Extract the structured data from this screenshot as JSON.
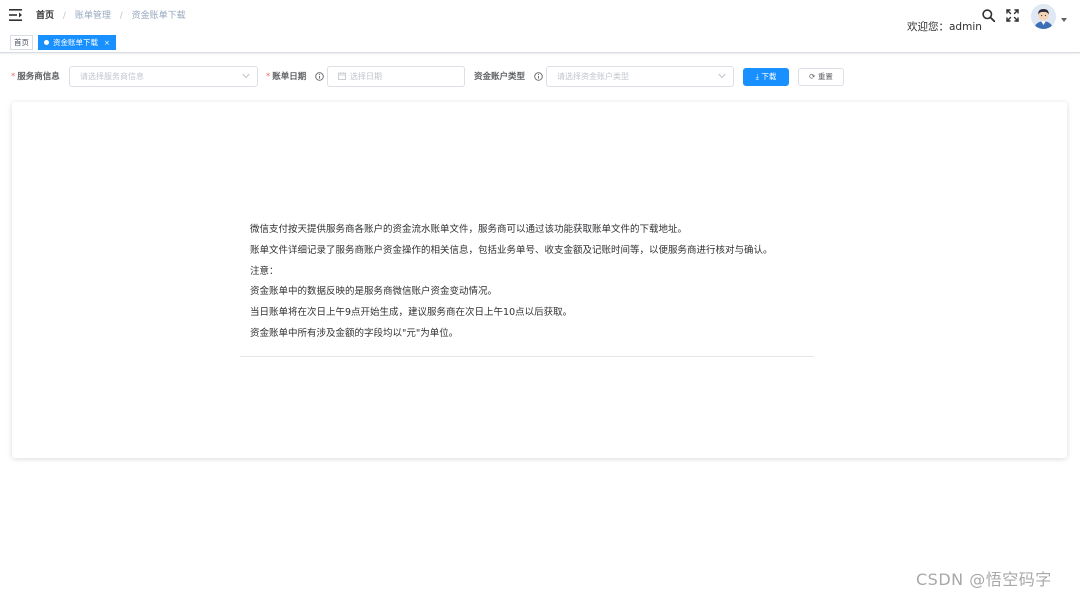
{
  "navbar": {
    "breadcrumb": [
      "首页",
      "账单管理",
      "资金账单下载"
    ],
    "breadcrumb_sep": "/",
    "welcome_text": "欢迎您：admin"
  },
  "tags": {
    "home": "首页",
    "active": "资金账单下载",
    "close": "×"
  },
  "form": {
    "merchant_label": "服务商信息",
    "merchant_placeholder": "请选择服务商信息",
    "date_label": "账单日期",
    "date_placeholder": "选择日期",
    "account_type_label": "资金账户类型",
    "account_type_placeholder": "请选择资金账户类型",
    "required_mark": "*",
    "download_button": "下载",
    "download_icon": "⤓",
    "reset_button": "重置",
    "reset_icon": "⟳"
  },
  "content": {
    "lines": [
      "微信支付按天提供服务商各账户的资金流水账单文件，服务商可以通过该功能获取账单文件的下载地址。",
      "账单文件详细记录了服务商账户资金操作的相关信息，包括业务单号、收支金额及记账时间等，以便服务商进行核对与确认。",
      "注意：",
      "资金账单中的数据反映的是服务商微信账户资金变动情况。",
      "当日账单将在次日上午9点开始生成，建议服务商在次日上午10点以后获取。",
      "资金账单中所有涉及金额的字段均以\"元\"为单位。"
    ]
  },
  "watermark": "CSDN @悟空码字",
  "colors": {
    "primary": "#1890ff",
    "required": "#f56c6c"
  },
  "icons": [
    "hamburger-icon",
    "search-icon",
    "fullscreen-icon",
    "caret-down-icon",
    "help-icon",
    "calendar-icon",
    "chevron-down-icon",
    "download-icon",
    "refresh-icon"
  ]
}
